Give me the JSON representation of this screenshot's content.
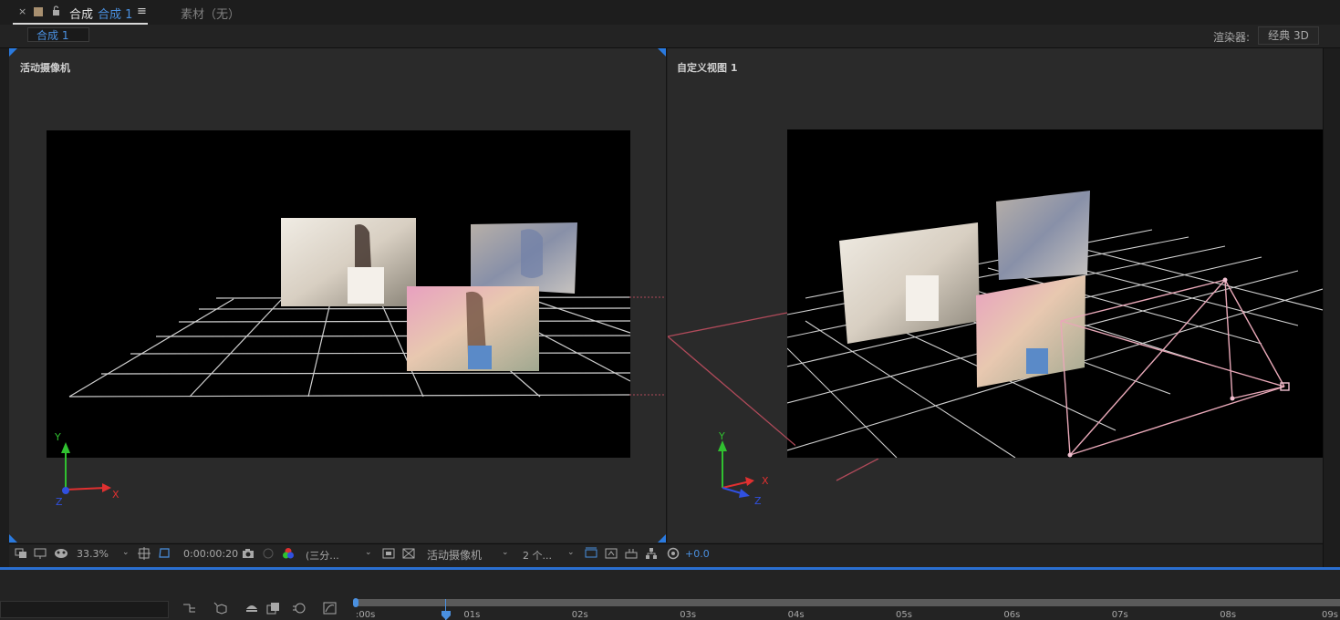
{
  "tabs": {
    "close": "×",
    "comp_prefix": "合成",
    "comp_name": "合成 1",
    "menu": "≡",
    "footage": "素材（无）"
  },
  "subbar": {
    "comp_tab": "合成 1",
    "renderer_label": "渲染器:",
    "renderer_value": "经典 3D"
  },
  "views": {
    "left_title": "活动摄像机",
    "right_title": "自定义视图 1"
  },
  "axes": {
    "x": "X",
    "y": "Y",
    "z": "Z"
  },
  "toolbar": {
    "zoom": "33.3%",
    "timecode": "0:00:00:20",
    "resolution": "(三分...",
    "camera": "活动摄像机",
    "views_count": "2 个...",
    "exposure": "+0.0"
  },
  "timeline": {
    "ticks": [
      ":00s",
      "01s",
      "02s",
      "03s",
      "04s",
      "05s",
      "06s",
      "07s",
      "08s",
      "09s"
    ],
    "playhead_seconds": 0.83
  },
  "colors": {
    "accent": "#2a6fd1",
    "camera_line": "#b04a5a",
    "axis_x": "#e03030",
    "axis_y": "#30c030",
    "axis_z": "#3050e0"
  }
}
